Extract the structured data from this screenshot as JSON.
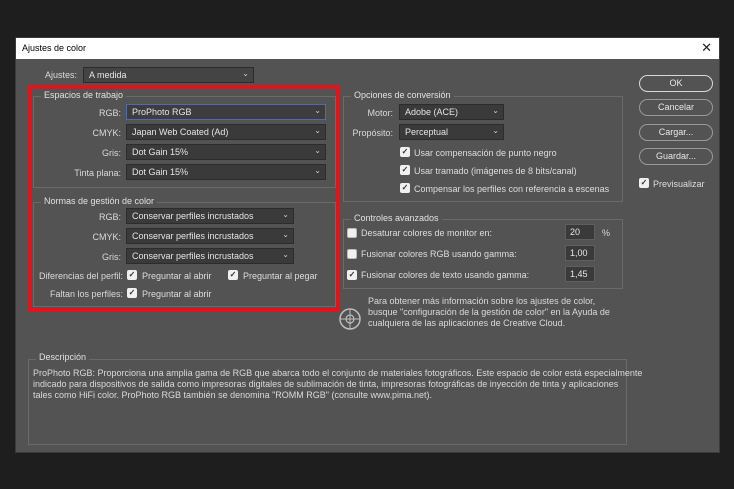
{
  "dialog": {
    "title": "Ajustes de color",
    "close_glyph": "✕"
  },
  "ajustes": {
    "label": "Ajustes:",
    "value": "A medida"
  },
  "workspaces": {
    "title": "Espacios de trabajo",
    "rgb": {
      "label": "RGB:",
      "value": "ProPhoto RGB"
    },
    "cmyk": {
      "label": "CMYK:",
      "value": "Japan Web Coated (Ad)"
    },
    "gris": {
      "label": "Gris:",
      "value": "Dot Gain 15%"
    },
    "tinta": {
      "label": "Tinta plana:",
      "value": "Dot Gain 15%"
    }
  },
  "policies": {
    "title": "Normas de gestión de color",
    "rgb": {
      "label": "RGB:",
      "value": "Conservar perfiles incrustados"
    },
    "cmyk": {
      "label": "CMYK:",
      "value": "Conservar perfiles incrustados"
    },
    "gris": {
      "label": "Gris:",
      "value": "Conservar perfiles incrustados"
    },
    "diferencias_label": "Diferencias del perfil:",
    "preguntar_abrir": "Preguntar al abrir",
    "preguntar_pegar": "Preguntar al pegar",
    "faltan_label": "Faltan los perfiles:",
    "faltan_preguntar": "Preguntar al abrir"
  },
  "conversion": {
    "title": "Opciones de conversión",
    "motor": {
      "label": "Motor:",
      "value": "Adobe (ACE)"
    },
    "proposito": {
      "label": "Propósito:",
      "value": "Perceptual"
    },
    "cb_punto_negro": "Usar compensación de punto negro",
    "cb_tramado": "Usar tramado (imágenes de 8 bits/canal)",
    "cb_compensar": "Compensar los perfiles con referencia a escenas"
  },
  "advanced": {
    "title": "Controles avanzados",
    "desaturar": {
      "label": "Desaturar colores de monitor en:",
      "value": "20",
      "unit": "%"
    },
    "fusionar_rgb": {
      "label": "Fusionar colores RGB usando gamma:",
      "value": "1,00"
    },
    "fusionar_texto": {
      "label": "Fusionar colores de texto usando gamma:",
      "value": "1,45"
    }
  },
  "info": {
    "line1": "Para obtener más información sobre los ajustes de color,",
    "line2": "busque \"configuración de la gestión de color\" en la Ayuda de",
    "line3": "cualquiera de las aplicaciones de Creative Cloud."
  },
  "description": {
    "title": "Descripción",
    "line1": "ProPhoto RGB: Proporciona una amplia gama de RGB que abarca todo el conjunto de materiales fotográficos. Este espacio de color está especialmente",
    "line2": "indicado para dispositivos de salida como impresoras digitales de sublimación de tinta, impresoras fotográficas de inyección de tinta y aplicaciones",
    "line3": "tales como HiFi color. ProPhoto RGB también se denomina \"ROMM RGB\" (consulte www.pima.net)."
  },
  "buttons": {
    "ok": "OK",
    "cancel": "Cancelar",
    "load": "Cargar...",
    "save": "Guardar...",
    "preview": "Previsualizar"
  },
  "colors": {
    "highlight": "#e0141c",
    "panel": "#535353"
  }
}
